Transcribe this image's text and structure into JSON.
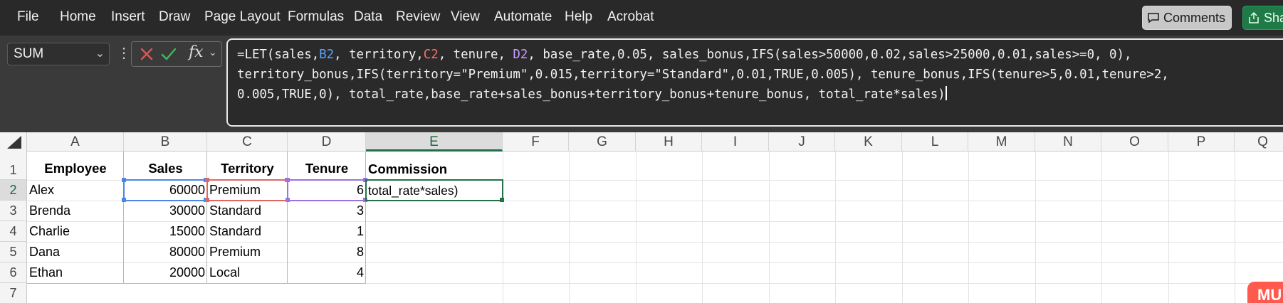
{
  "menu": {
    "items": [
      "File",
      "Home",
      "Insert",
      "Draw",
      "Page Layout",
      "Formulas",
      "Data",
      "Review",
      "View",
      "Automate",
      "Help",
      "Acrobat"
    ],
    "comments_label": "Comments",
    "share_label": "Sha"
  },
  "formula_bar": {
    "name_box": "SUM",
    "fx_symbol": "fx",
    "line1": {
      "a": "=LET(sales,",
      "b2": "B2",
      "b": ", territory,",
      "c2": "C2",
      "c": ", tenure, ",
      "d2": "D2",
      "d": ", base_rate,0.05, sales_bonus,IFS(sales>50000,0.02,sales>25000,0.01,sales>=0, 0),"
    },
    "line2": "territory_bonus,IFS(territory=\"Premium\",0.015,territory=\"Standard\",0.01,TRUE,0.005), tenure_bonus,IFS(tenure>5,0.01,tenure>2,",
    "line3": "0.005,TRUE,0), total_rate,base_rate+sales_bonus+territory_bonus+tenure_bonus, total_rate*sales)"
  },
  "grid": {
    "columns": [
      "A",
      "B",
      "C",
      "D",
      "E",
      "F",
      "G",
      "H",
      "I",
      "J",
      "K",
      "L",
      "M",
      "N",
      "O",
      "P",
      "Q"
    ],
    "rows": [
      "1",
      "2",
      "3",
      "4",
      "5",
      "6",
      "7"
    ],
    "active_cell": "E2",
    "headers": {
      "a": "Employee",
      "b": "Sales",
      "c": "Territory",
      "d": "Tenure",
      "e": "Commission"
    },
    "data": [
      {
        "employee": "Alex",
        "sales": "60000",
        "territory": "Premium",
        "tenure": "6"
      },
      {
        "employee": "Brenda",
        "sales": "30000",
        "territory": "Standard",
        "tenure": "3"
      },
      {
        "employee": "Charlie",
        "sales": "15000",
        "territory": "Standard",
        "tenure": "1"
      },
      {
        "employee": "Dana",
        "sales": "80000",
        "territory": "Premium",
        "tenure": "8"
      },
      {
        "employee": "Ethan",
        "sales": "20000",
        "territory": "Local",
        "tenure": "4"
      }
    ],
    "e2_edit_text": "total_rate*sales)"
  },
  "watermark": "MU",
  "colors": {
    "ref_b2": "#4a86e8",
    "ref_c2": "#e06666",
    "ref_d2": "#9b72e0",
    "active": "#217346"
  }
}
